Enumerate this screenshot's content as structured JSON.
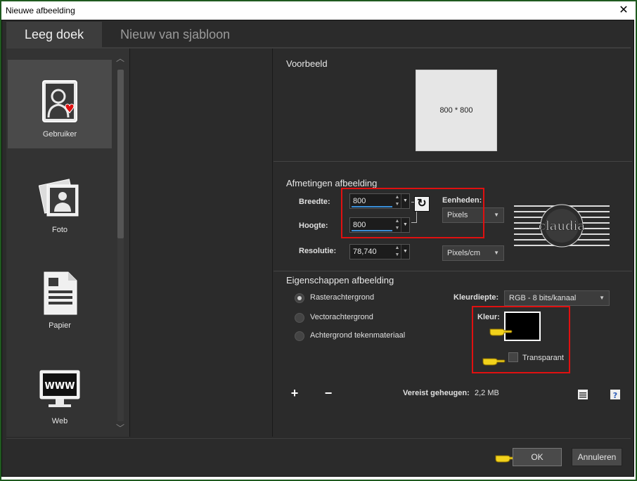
{
  "window": {
    "title": "Nieuwe afbeelding",
    "close_glyph": "✕"
  },
  "tabs": [
    {
      "label": "Leeg doek",
      "active": true
    },
    {
      "label": "Nieuw van sjabloon",
      "active": false
    }
  ],
  "categories": [
    {
      "label": "Gebruiker",
      "icon": "user-heart-icon",
      "selected": true
    },
    {
      "label": "Foto",
      "icon": "photo-icon",
      "selected": false
    },
    {
      "label": "Papier",
      "icon": "paper-icon",
      "selected": false
    },
    {
      "label": "Web",
      "icon": "web-monitor-icon",
      "selected": false
    }
  ],
  "preview": {
    "title": "Voorbeeld",
    "text": "800 * 800"
  },
  "dimensions": {
    "title": "Afmetingen afbeelding",
    "width_label": "Breedte:",
    "width_value": "800",
    "height_label": "Hoogte:",
    "height_value": "800",
    "resolution_label": "Resolutie:",
    "resolution_value": "78,740",
    "units_label": "Eenheden:",
    "units_value": "Pixels",
    "resolution_units_value": "Pixels/cm"
  },
  "properties": {
    "title": "Eigenschappen afbeelding",
    "background_options": [
      {
        "label": "Rasterachtergrond",
        "selected": true
      },
      {
        "label": "Vectorachtergrond",
        "selected": false
      },
      {
        "label": "Achtergrond tekenmateriaal",
        "selected": false
      }
    ],
    "color_depth_label": "Kleurdiepte:",
    "color_depth_value": "RGB - 8 bits/kanaal",
    "color_label": "Kleur:",
    "color_value": "#000000",
    "transparent_label": "Transparant",
    "transparent_checked": false
  },
  "memory": {
    "label": "Vereist geheugen:",
    "value": "2,2 MB"
  },
  "buttons": {
    "ok": "OK",
    "cancel": "Annuleren"
  },
  "logo_text": "claudia",
  "colors": {
    "accent_red": "#e01010",
    "accent_blue": "#3a8fd8",
    "hand_yellow": "#f2d21b"
  }
}
